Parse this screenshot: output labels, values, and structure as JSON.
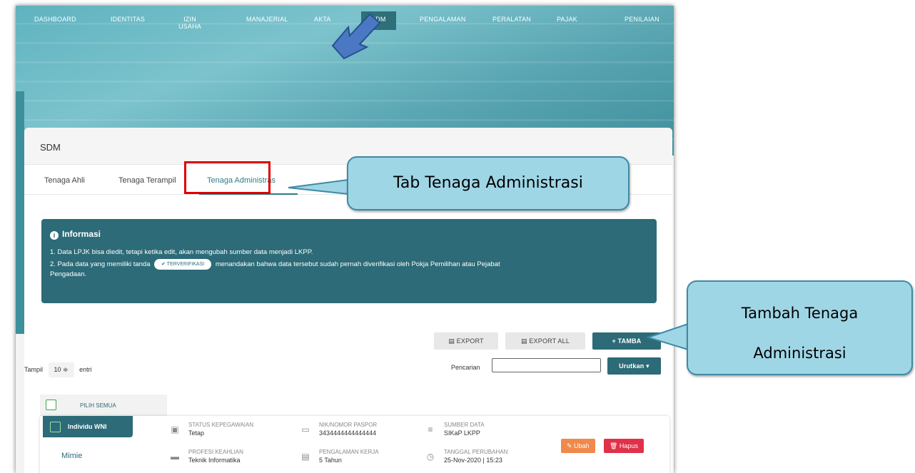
{
  "nav": {
    "items": [
      "DASHBOARD",
      "IDENTITAS",
      "IZIN\nUSAHA",
      "MANAJERIAL",
      "AKTA",
      "SDM",
      "PENGALAMAN",
      "PERALATAN",
      "PAJAK",
      "PENILAIAN"
    ],
    "active": "SDM"
  },
  "card": {
    "title": "SDM",
    "tabs": [
      "Tenaga Ahli",
      "Tenaga Terampil",
      "Tenaga Administras"
    ],
    "active_tab": "Tenaga Administras"
  },
  "info": {
    "title": "Informasi",
    "line1": "1. Data LPJK bisa diedit, tetapi ketika edit, akan mengubah sumber data menjadi LKPP.",
    "line2_before": "2. Pada data yang memiliki tanda",
    "badge": "✔ TERVERIFIKASI",
    "line2_after": "menandakan bahwa data tersebut sudah pernah diverifikasi oleh Pokja Pemilihan atau Pejabat",
    "line3": "Pengadaan."
  },
  "toolbar": {
    "export": "▤  EXPORT",
    "export_all": "▤  EXPORT ALL",
    "tambah": "+  TAMBA"
  },
  "table_controls": {
    "show_label": "Tampil",
    "show_value": "10  ≑",
    "entries_label": "entri",
    "search_label": "Pencarian",
    "search_value": "",
    "sort_label": "Urutkan ▾"
  },
  "select_all": "PILIH SEMUA",
  "row": {
    "tag": "Individu WNI",
    "name": "Mimie",
    "status_label": "STATUS KEPEGAWAIAN",
    "status_value": "Tetap",
    "profesi_label": "PROFESI KEAHLIAN",
    "profesi_value": "Teknik Informatika",
    "nik_label": "NIK/NOMOR PASPOR",
    "nik_value": "3434444444444444",
    "pengalaman_label": "PENGALAMAN KERJA",
    "pengalaman_value": "5 Tahun",
    "sumber_label": "SUMBER DATA",
    "sumber_value": "SIKaP LKPP",
    "tanggal_label": "TANGGAL PERUBAHAN",
    "tanggal_value": "25-Nov-2020 | 15:23",
    "ubah": "✎ Ubah",
    "hapus": "🗑 Hapus"
  },
  "callouts": {
    "tab": "Tab Tenaga Administrasi",
    "tambah_line1": "Tambah Tenaga",
    "tambah_line2": "Administrasi"
  },
  "colors": {
    "teal": "#2c6b77",
    "callout_fill": "#9fd6e6",
    "highlight": "#e00000",
    "ubah": "#f0894b",
    "hapus": "#e0304a"
  }
}
